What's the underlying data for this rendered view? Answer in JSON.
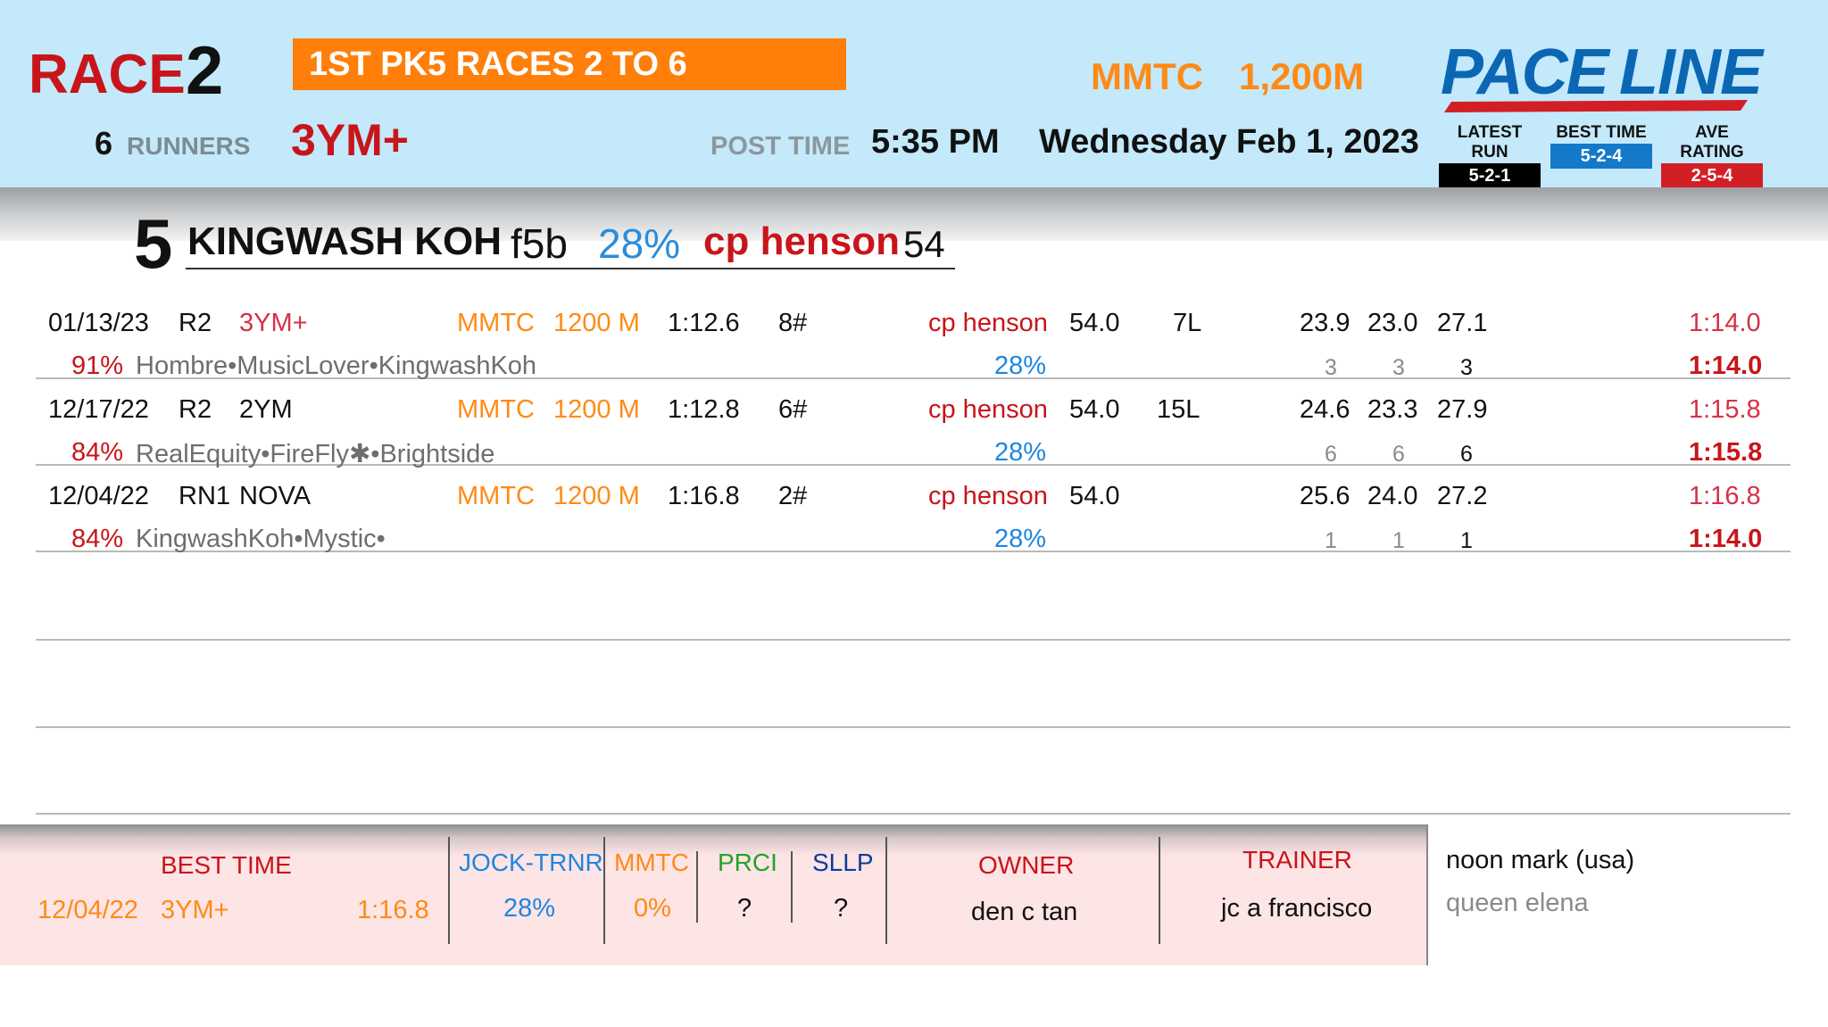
{
  "header": {
    "race_word": "RACE",
    "race_number": "2",
    "pk5_banner": "1ST PK5 RACES 2 TO 6",
    "runners_count": "6",
    "runners_word": "RUNNERS",
    "age_class": "3YM+",
    "track": "MMTC",
    "distance": "1,200M",
    "post_time_label": "POST TIME",
    "post_time": "5:35 PM",
    "date": "Wednesday  Feb 1, 2023"
  },
  "logo": {
    "pace": "PACE",
    "line": "LINE",
    "legend": [
      {
        "label": "LATEST RUN",
        "value": "5-2-1",
        "color": "#000000"
      },
      {
        "label": "BEST TIME",
        "value": "5-2-4",
        "color": "#1479c9"
      },
      {
        "label": "AVE RATING",
        "value": "2-5-4",
        "color": "#d21f26"
      }
    ]
  },
  "horse": {
    "number": "5",
    "name": "KINGWASH KOH",
    "sex_color": "f5b",
    "pct": "28%",
    "jockey": "cp henson",
    "weight": "54"
  },
  "races": [
    {
      "date": "01/13/23",
      "race": "R2",
      "class": "3YM+",
      "track": "MMTC",
      "dist": "1200 M",
      "time": "1:12.6",
      "gate": "8#",
      "jockey": "cp henson",
      "weight": "54.0",
      "margin": "7L",
      "splits": [
        "23.9",
        "23.0",
        "27.1"
      ],
      "final_time": "1:14.0",
      "rating": "91%",
      "finishers": "Hombre•MusicLover•KingwashKoh",
      "jockey_pct": "28%",
      "positions": [
        "3",
        "3",
        "3"
      ],
      "best_time": "1:14.0"
    },
    {
      "date": "12/17/22",
      "race": "R2",
      "class": "2YM",
      "track": "MMTC",
      "dist": "1200 M",
      "time": "1:12.8",
      "gate": "6#",
      "jockey": "cp henson",
      "weight": "54.0",
      "margin": "15L",
      "splits": [
        "24.6",
        "23.3",
        "27.9"
      ],
      "final_time": "1:15.8",
      "rating": "84%",
      "finishers": "RealEquity•FireFly✱•Brightside",
      "jockey_pct": "28%",
      "positions": [
        "6",
        "6",
        "6"
      ],
      "best_time": "1:15.8"
    },
    {
      "date": "12/04/22",
      "race": "RN1",
      "class": "NOVA",
      "track": "MMTC",
      "dist": "1200 M",
      "time": "1:16.8",
      "gate": "2#",
      "jockey": "cp henson",
      "weight": "54.0",
      "margin": "",
      "splits": [
        "25.6",
        "24.0",
        "27.2"
      ],
      "final_time": "1:16.8",
      "rating": "84%",
      "finishers": "KingwashKoh•Mystic•",
      "jockey_pct": "28%",
      "positions": [
        "1",
        "1",
        "1"
      ],
      "best_time": "1:14.0"
    }
  ],
  "footer": {
    "best_time_label": "BEST TIME",
    "best_time_date": "12/04/22",
    "best_time_class": "3YM+",
    "best_time_value": "1:16.8",
    "jock_trnr_label": "JOCK-TRNR",
    "jock_trnr_value": "28%",
    "mmtc_label": "MMTC",
    "mmtc_value": "0%",
    "prci_label": "PRCI",
    "prci_value": "?",
    "sllp_label": "SLLP",
    "sllp_value": "?",
    "owner_label": "OWNER",
    "owner_value": "den c tan",
    "trainer_label": "TRAINER",
    "trainer_value": "jc a francisco",
    "sire": "noon mark (usa)",
    "dam": "queen elena"
  }
}
